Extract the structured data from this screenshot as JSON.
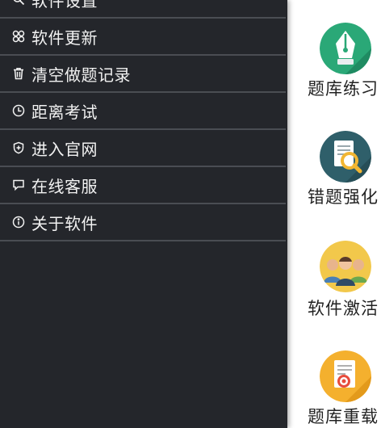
{
  "menu": {
    "items": [
      {
        "label": "软件设置",
        "icon": "search-settings-icon"
      },
      {
        "label": "软件更新",
        "icon": "grid-icon"
      },
      {
        "label": "清空做题记录",
        "icon": "trash-icon"
      },
      {
        "label": "距离考试",
        "icon": "clock-icon"
      },
      {
        "label": "进入官网",
        "icon": "shield-plus-icon"
      },
      {
        "label": "在线客服",
        "icon": "chat-icon"
      },
      {
        "label": "关于软件",
        "icon": "info-icon"
      }
    ]
  },
  "tiles": [
    {
      "label": "题库练习",
      "icon": "pen-nib-icon",
      "color": "#2aa877"
    },
    {
      "label": "错题强化",
      "icon": "document-magnifier-icon",
      "color": "#2f5f6a"
    },
    {
      "label": "软件激活",
      "icon": "people-group-icon",
      "color": "#f2c84b"
    },
    {
      "label": "题库重载",
      "icon": "document-target-icon",
      "color": "#f4b02e"
    }
  ],
  "colors": {
    "drawer_bg": "#24262b",
    "divider": "#4a4d53",
    "menu_text": "#f2f2f2"
  }
}
